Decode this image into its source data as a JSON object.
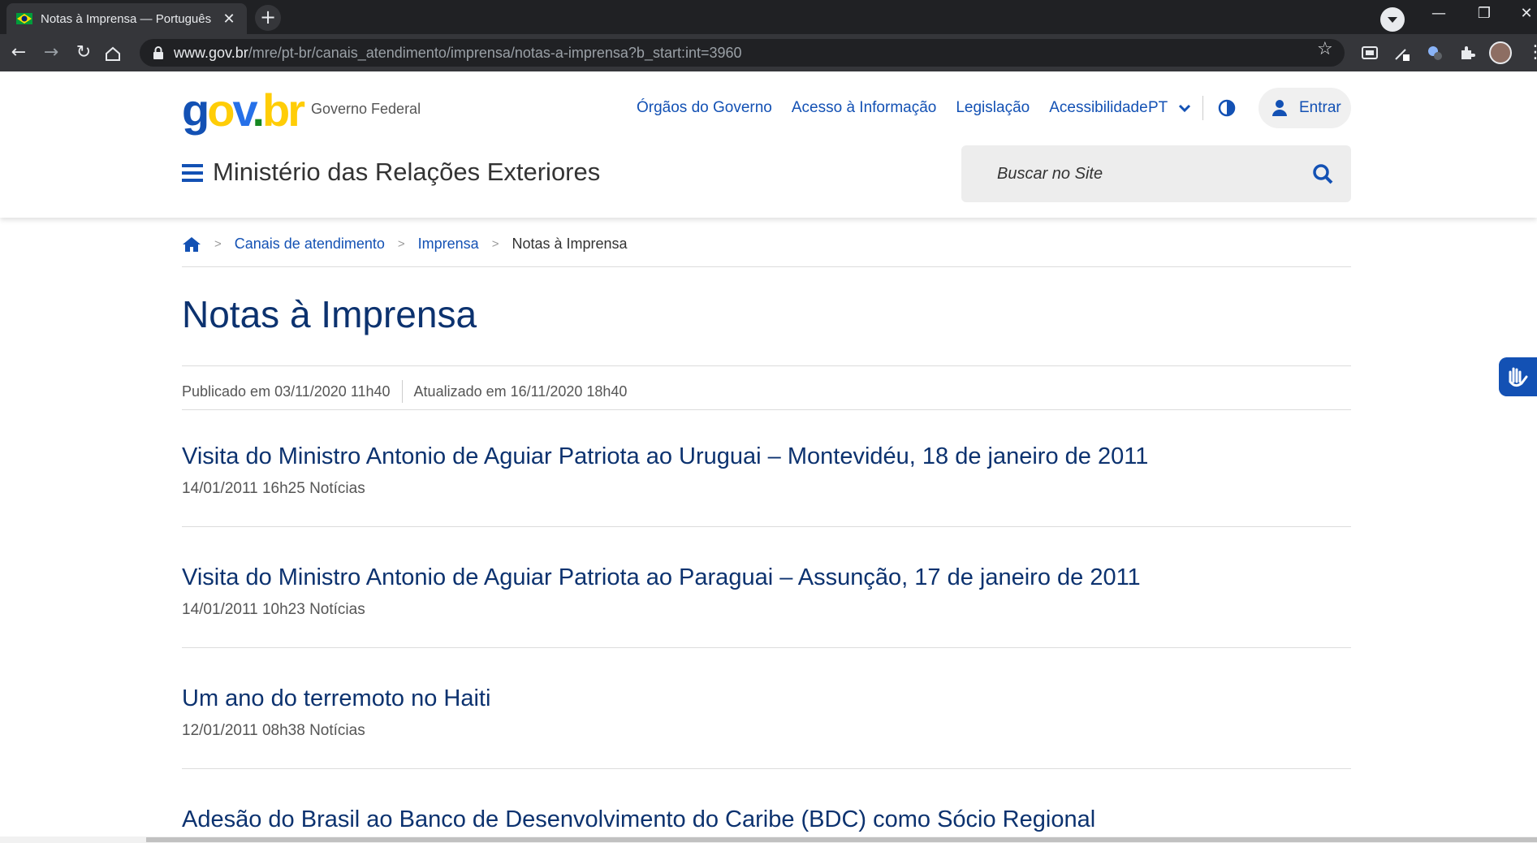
{
  "browser": {
    "tab_title": "Notas à Imprensa — Português (",
    "new_tab": "+",
    "close_tab": "✕",
    "url_host": "www.gov.br",
    "url_path": "/mre/pt-br/canais_atendimento/imprensa/notas-a-imprensa?b_start:int=3960",
    "window_buttons": {
      "minimize": "—",
      "restore": "❐",
      "close": "✕"
    }
  },
  "header": {
    "logo": {
      "g": "g",
      "o": "o",
      "v": "v",
      "dot": ".",
      "br": "br"
    },
    "gov_federal": "Governo Federal",
    "links": [
      "Órgãos do Governo",
      "Acesso à Informação",
      "Legislação",
      "Acessibilidade"
    ],
    "language": "PT",
    "login_label": "Entrar",
    "ministry": "Ministério das Relações Exteriores",
    "search_placeholder": "Buscar no Site"
  },
  "breadcrumb": {
    "separator": ">",
    "items": [
      "Canais de atendimento",
      "Imprensa"
    ],
    "current": "Notas à Imprensa"
  },
  "page": {
    "title": "Notas à Imprensa",
    "published": "Publicado em 03/11/2020 11h40",
    "updated": "Atualizado em 16/11/2020 18h40"
  },
  "news": [
    {
      "title": "Visita do Ministro Antonio de Aguiar Patriota ao Uruguai – Montevidéu, 18 de janeiro de 2011",
      "meta": "14/01/2011 16h25 Notícias"
    },
    {
      "title": "Visita do Ministro Antonio de Aguiar Patriota ao Paraguai – Assunção, 17 de janeiro de 2011",
      "meta": "14/01/2011 10h23 Notícias"
    },
    {
      "title": "Um ano do terremoto no Haiti",
      "meta": "12/01/2011 08h38 Notícias"
    },
    {
      "title": "Adesão do Brasil ao Banco de Desenvolvimento do Caribe (BDC) como Sócio Regional",
      "meta": ""
    }
  ],
  "colors": {
    "primary": "#1351b4",
    "title": "#0c326f",
    "chrome": "#202124"
  }
}
